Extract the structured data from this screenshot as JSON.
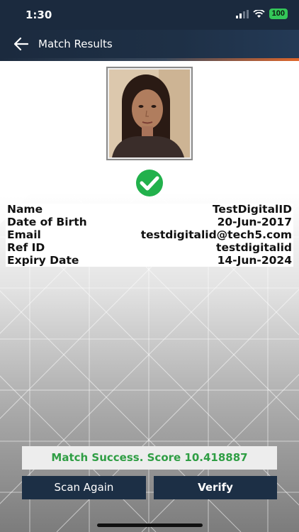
{
  "status_bar": {
    "time": "1:30",
    "battery": "100"
  },
  "header": {
    "title": "Match Results"
  },
  "result": {
    "match_status": "success"
  },
  "details": [
    {
      "label": "Name",
      "value": "TestDigitalID"
    },
    {
      "label": "Date of Birth",
      "value": "20-Jun-2017"
    },
    {
      "label": "Email",
      "value": "testdigitalid@tech5.com"
    },
    {
      "label": "Ref ID",
      "value": "testdigitalid"
    },
    {
      "label": "Expiry Date",
      "value": "14-Jun-2024"
    }
  ],
  "match_message": "Match Success. Score 10.418887",
  "buttons": {
    "scan_again": "Scan Again",
    "verify": "Verify"
  },
  "colors": {
    "header_bg": "#1b2a3e",
    "accent": "#e0672b",
    "success": "#2f9e44",
    "check_bg": "#22b14c",
    "button_bg": "#1c2f45"
  },
  "icons": {
    "back": "arrow-left-icon",
    "check": "check-circle-icon",
    "signal": "signal-icon",
    "wifi": "wifi-icon",
    "battery": "battery-icon"
  }
}
